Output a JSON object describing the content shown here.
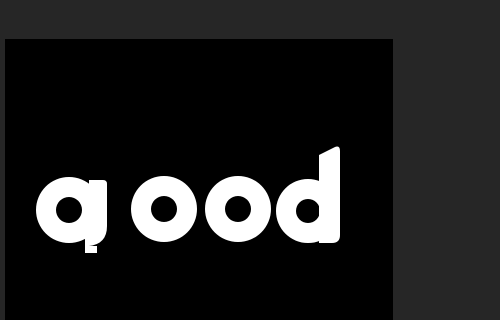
{
  "artwork": {
    "text": "good"
  },
  "colors": {
    "workspace_bg": "#262626",
    "canvas_bg": "#000000",
    "text_fill": "#ffffff"
  }
}
